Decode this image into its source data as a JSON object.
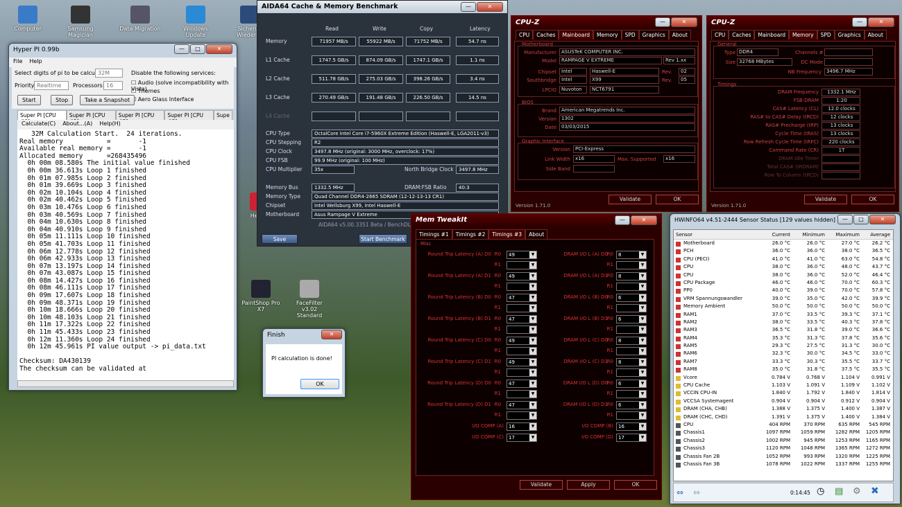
{
  "desktop_icons": [
    {
      "label": "Computer",
      "icon": "computer-icon"
    },
    {
      "label": "Samsung Magician",
      "icon": "ssd-icon"
    },
    {
      "label": "Data Migration",
      "icon": "migration-icon"
    },
    {
      "label": "Windows Update",
      "icon": "update-icon"
    },
    {
      "label": "Sicherun Wiederhe",
      "icon": "backup-icon"
    },
    {
      "label": "PaintShop Pro X7",
      "icon": "paintshop-icon"
    },
    {
      "label": "FaceFilter v3.02 Standard",
      "icon": "facefilter-icon"
    },
    {
      "label": "Hero 2",
      "icon": "hero-icon"
    }
  ],
  "hyperpi": {
    "title": "Hyper PI 0.99b",
    "menu": [
      "File",
      "Help"
    ],
    "digits_label": "Select digits of pi to be calculated:",
    "digits_value": "32M",
    "disable_label": "Disable the following services:",
    "checks": [
      "Audio (solve incompatibility with Vista)",
      "Themes",
      "Aero Glass Interface"
    ],
    "priority_label": "Priority:",
    "priority_value": "Realtime",
    "processors_label": "Processors:",
    "processors_value": "16",
    "buttons": [
      "Start",
      "Stop",
      "Take a Snapshot"
    ],
    "tabs": [
      "Super PI [CPU #0]",
      "Super PI [CPU #1]",
      "Super PI [CPU #2]",
      "Super PI [CPU #3]",
      "Supe"
    ],
    "submenu": [
      "Calculate(C)",
      "About...(A)",
      "Help(H)"
    ],
    "console": "   32M Calculation Start.  24 iterations.\nReal memory           =       -1\nAvailable real memory =       -1\nAllocated memory      =268435496\n  0h 00m 08.580s The initial value finished\n  0h 00m 36.613s Loop 1 finished\n  0h 01m 07.985s Loop 2 finished\n  0h 01m 39.669s Loop 3 finished\n  0h 02m 10.104s Loop 4 finished\n  0h 02m 40.462s Loop 5 finished\n  0h 03m 10.476s Loop 6 finished\n  0h 03m 40.569s Loop 7 finished\n  0h 04m 10.630s Loop 8 finished\n  0h 04m 40.910s Loop 9 finished\n  0h 05m 11.111s Loop 10 finished\n  0h 05m 41.703s Loop 11 finished\n  0h 06m 12.778s Loop 12 finished\n  0h 06m 42.933s Loop 13 finished\n  0h 07m 13.197s Loop 14 finished\n  0h 07m 43.087s Loop 15 finished\n  0h 08m 14.427s Loop 16 finished\n  0h 08m 46.111s Loop 17 finished\n  0h 09m 17.607s Loop 18 finished\n  0h 09m 48.371s Loop 19 finished\n  0h 10m 18.666s Loop 20 finished\n  0h 10m 48.103s Loop 21 finished\n  0h 11m 17.322s Loop 22 finished\n  0h 11m 45.433s Loop 23 finished\n  0h 12m 11.360s Loop 24 finished\n  0h 12m 45.961s PI value output -> pi_data.txt\n\nChecksum: DA430139\nThe checksum can be validated at"
  },
  "finish": {
    "title": "Finish",
    "message": "PI calculation is done!",
    "ok": "OK"
  },
  "aida": {
    "title": "AIDA64 Cache & Memory Benchmark",
    "headers": [
      "Read",
      "Write",
      "Copy",
      "Latency"
    ],
    "rows": [
      {
        "label": "Memory",
        "vals": [
          "71957 MB/s",
          "55922 MB/s",
          "71752 MB/s",
          "54.7 ns"
        ]
      },
      {
        "label": "L1 Cache",
        "vals": [
          "1747.5 GB/s",
          "874.09 GB/s",
          "1747.1 GB/s",
          "1.1 ns"
        ]
      },
      {
        "label": "L2 Cache",
        "vals": [
          "511.78 GB/s",
          "275.03 GB/s",
          "398.26 GB/s",
          "3.4 ns"
        ]
      },
      {
        "label": "L3 Cache",
        "vals": [
          "270.49 GB/s",
          "191.48 GB/s",
          "226.50 GB/s",
          "14.5 ns"
        ]
      },
      {
        "label": "L4 Cache",
        "vals": [
          "",
          "",
          "",
          ""
        ]
      }
    ],
    "info": [
      {
        "label": "CPU Type",
        "value": "OctalCore Intel Core i7-5960X Extreme Edition  (Haswell-E, LGA2011-v3)"
      },
      {
        "label": "CPU Stepping",
        "value": "R2"
      },
      {
        "label": "CPU Clock",
        "value": "3497.8 MHz  (original: 3000 MHz, overclock: 17%)"
      },
      {
        "label": "CPU FSB",
        "value": "99.9 MHz  (original: 100 MHz)"
      },
      {
        "label": "CPU Multiplier",
        "value": "35x"
      }
    ],
    "nb_label": "North Bridge Clock",
    "nb_value": "3497.8 MHz",
    "membus_label": "Memory Bus",
    "membus_value": "1332.5 MHz",
    "ratio_label": "DRAM:FSB Ratio",
    "ratio_value": "40:3",
    "info2": [
      {
        "label": "Memory Type",
        "value": "Quad Channel DDR4-2665 SDRAM  (12-12-13-13 CR1)"
      },
      {
        "label": "Chipset",
        "value": "Intel Wellsburg X99, Intel Haswell-E"
      },
      {
        "label": "Motherboard",
        "value": "Asus Rampage V Extreme"
      }
    ],
    "footer": "AIDA64 v5.00.3351 Beta / BenchDLL 4.",
    "save": "Save",
    "start": "Start Benchmark"
  },
  "cpuz1": {
    "title": "CPU-Z",
    "tabs": [
      "CPU",
      "Caches",
      "Mainboard",
      "Memory",
      "SPD",
      "Graphics",
      "About"
    ],
    "active": "Mainboard",
    "mb_group": "Motherboard",
    "manufacturer_label": "Manufacturer",
    "manufacturer": "ASUSTeK COMPUTER INC.",
    "model_label": "Model",
    "model": "RAMPAGE V EXTREME",
    "model_rev": "Rev 1.xx",
    "chipset_label": "Chipset",
    "chipset_vendor": "Intel",
    "chipset_name": "Haswell-E",
    "rev_label": "Rev.",
    "chipset_rev": "02",
    "south_label": "Southbridge",
    "south_vendor": "Intel",
    "south_name": "X99",
    "south_rev": "05",
    "lpcio_label": "LPCIO",
    "lpcio_vendor": "Nuvoton",
    "lpcio_name": "NCT6791",
    "bios_group": "BIOS",
    "brand_label": "Brand",
    "brand": "American Megatrends Inc.",
    "version_label": "Version",
    "version": "1302",
    "date_label": "Date",
    "date": "03/03/2015",
    "gi_group": "Graphic Interface",
    "gi_version_label": "Version",
    "gi_version": "PCI-Express",
    "link_label": "Link Width",
    "link": "x16",
    "max_label": "Max. Supported",
    "max": "x16",
    "side_label": "Side Band",
    "validate": "Validate",
    "ok": "OK",
    "ver": "Version 1.71.0"
  },
  "cpuz2": {
    "title": "CPU-Z",
    "tabs": [
      "CPU",
      "Caches",
      "Mainboard",
      "Memory",
      "SPD",
      "Graphics",
      "About"
    ],
    "active": "Memory",
    "general_group": "General",
    "type_label": "Type",
    "type": "DDR4",
    "channels_label": "Channels #",
    "size_label": "Size",
    "size": "32768 MBytes",
    "dc_label": "DC Mode",
    "nb_label": "NB Frequency",
    "nb": "3496.7 MHz",
    "timings_group": "Timings",
    "timings": [
      {
        "label": "DRAM Frequency",
        "value": "1332.1 MHz"
      },
      {
        "label": "FSB:DRAM",
        "value": "1:20"
      },
      {
        "label": "CAS# Latency (CL)",
        "value": "12.0 clocks"
      },
      {
        "label": "RAS# to CAS# Delay (tRCD)",
        "value": "12 clocks"
      },
      {
        "label": "RAS# Precharge (tRP)",
        "value": "13 clocks"
      },
      {
        "label": "Cycle Time (tRAS)",
        "value": "13 clocks"
      },
      {
        "label": "Row Refresh Cycle Time (tRFC)",
        "value": "220 clocks"
      },
      {
        "label": "Command Rate (CR)",
        "value": "1T"
      },
      {
        "label": "DRAM Idle Timer",
        "value": ""
      },
      {
        "label": "Total CAS# (tRDRAM)",
        "value": ""
      },
      {
        "label": "Row To Column (tRCD)",
        "value": ""
      }
    ],
    "validate": "Validate",
    "ok": "OK",
    "ver": "Version 1.71.0"
  },
  "mti": {
    "title": "Mem TweakIt",
    "tabs": [
      "Timings #1",
      "Timings #2",
      "Timings #3",
      "About"
    ],
    "active": "Timings #3",
    "group": "Misc",
    "left": [
      {
        "label": "Round Trip Latency (A) D0",
        "r0": "49"
      },
      {
        "label": "Round Trip Latency (A) D1",
        "r0": "49"
      },
      {
        "label": "Round Trip Latency (B) D0",
        "r0": "47"
      },
      {
        "label": "Round Trip Latency (B) D1",
        "r0": "47"
      },
      {
        "label": "Round Trip Latency (C) D0",
        "r0": "49"
      },
      {
        "label": "Round Trip Latency (C) D1",
        "r0": "49"
      },
      {
        "label": "Round Trip Latency (D) D0",
        "r0": "47"
      },
      {
        "label": "Round Trip Latency (D) D1",
        "r0": "47"
      }
    ],
    "right": [
      {
        "label": "DRAM I/O L (A) D0",
        "r0": "8"
      },
      {
        "label": "DRAM I/O L (A) D1",
        "r0": "8"
      },
      {
        "label": "DRAM I/O L (B) D0",
        "r0": "6"
      },
      {
        "label": "DRAM I/O L (B) D1",
        "r0": "6"
      },
      {
        "label": "DRAM I/O L (C) D0",
        "r0": "8"
      },
      {
        "label": "DRAM I/O L (C) D1",
        "r0": "8"
      },
      {
        "label": "DRAM I/O L (D) D0",
        "r0": "6"
      },
      {
        "label": "DRAM I/O L (D) D1",
        "r0": "6"
      }
    ],
    "r0": "R0",
    "r1": "R1",
    "io": [
      {
        "label": "I/O COMP (A)",
        "value": "16"
      },
      {
        "label": "I/O COMP (C)",
        "value": "17"
      },
      {
        "label": "I/O COMP (B)",
        "value": "16"
      },
      {
        "label": "I/O COMP (D)",
        "value": "17"
      }
    ],
    "validate": "Validate",
    "apply": "Apply",
    "ok": "OK"
  },
  "hw": {
    "title": "HWiNFO64 v4.51-2444 Sensor Status [129 values hidden]",
    "cols": [
      "Sensor",
      "Current",
      "Minimum",
      "Maximum",
      "Average"
    ],
    "rows": [
      [
        "Motherboard",
        "26.0 °C",
        "26.0 °C",
        "27.0 °C",
        "26.2 °C",
        "t"
      ],
      [
        "PCH",
        "36.0 °C",
        "36.0 °C",
        "38.0 °C",
        "36.5 °C",
        "t"
      ],
      [
        "CPU (PECI)",
        "41.0 °C",
        "41.0 °C",
        "63.0 °C",
        "54.8 °C",
        "t"
      ],
      [
        "CPU",
        "38.0 °C",
        "36.0 °C",
        "48.0 °C",
        "43.7 °C",
        "t"
      ],
      [
        "CPU",
        "38.0 °C",
        "36.0 °C",
        "52.0 °C",
        "46.4 °C",
        "t"
      ],
      [
        "CPU Package",
        "46.0 °C",
        "46.0 °C",
        "70.0 °C",
        "60.3 °C",
        "t"
      ],
      [
        "PP0",
        "40.0 °C",
        "39.0 °C",
        "70.0 °C",
        "57.8 °C",
        "t"
      ],
      [
        "VRM Spannungswandler",
        "39.0 °C",
        "35.0 °C",
        "42.0 °C",
        "39.9 °C",
        "t"
      ],
      [
        "Memory Ambient",
        "50.0 °C",
        "50.0 °C",
        "50.0 °C",
        "50.0 °C",
        "t"
      ],
      [
        "RAM1",
        "37.0 °C",
        "33.5 °C",
        "39.3 °C",
        "37.1 °C",
        "t"
      ],
      [
        "RAM2",
        "38.0 °C",
        "33.5 °C",
        "40.3 °C",
        "37.8 °C",
        "t"
      ],
      [
        "RAM3",
        "36.5 °C",
        "31.8 °C",
        "39.0 °C",
        "36.6 °C",
        "t"
      ],
      [
        "RAM4",
        "35.3 °C",
        "31.3 °C",
        "37.8 °C",
        "35.6 °C",
        "t"
      ],
      [
        "RAM5",
        "29.3 °C",
        "27.5 °C",
        "31.3 °C",
        "30.0 °C",
        "t"
      ],
      [
        "RAM6",
        "32.3 °C",
        "30.0 °C",
        "34.5 °C",
        "33.0 °C",
        "t"
      ],
      [
        "RAM7",
        "33.3 °C",
        "30.3 °C",
        "35.5 °C",
        "33.7 °C",
        "t"
      ],
      [
        "RAM8",
        "35.0 °C",
        "31.8 °C",
        "37.5 °C",
        "35.5 °C",
        "t"
      ],
      [
        "Vcore",
        "0.784 V",
        "0.768 V",
        "1.104 V",
        "0.991 V",
        "v"
      ],
      [
        "CPU Cache",
        "1.103 V",
        "1.091 V",
        "1.109 V",
        "1.102 V",
        "v"
      ],
      [
        "VCCIN CPU-IN",
        "1.840 V",
        "1.792 V",
        "1.840 V",
        "1.814 V",
        "v"
      ],
      [
        "VCCSA Systemagent",
        "0.904 V",
        "0.904 V",
        "0.912 V",
        "0.904 V",
        "v"
      ],
      [
        "DRAM (CHA, CHB)",
        "1.388 V",
        "1.375 V",
        "1.400 V",
        "1.387 V",
        "v"
      ],
      [
        "DRAM (CHC, CHD)",
        "1.391 V",
        "1.375 V",
        "1.400 V",
        "1.384 V",
        "v"
      ],
      [
        "CPU",
        "404 RPM",
        "370 RPM",
        "635 RPM",
        "545 RPM",
        "f"
      ],
      [
        "Chassis1",
        "1097 RPM",
        "1059 RPM",
        "1282 RPM",
        "1205 RPM",
        "f"
      ],
      [
        "Chassis2",
        "1002 RPM",
        "945 RPM",
        "1253 RPM",
        "1165 RPM",
        "f"
      ],
      [
        "Chassis3",
        "1120 RPM",
        "1048 RPM",
        "1365 RPM",
        "1272 RPM",
        "f"
      ],
      [
        "Chassis Fan 2B",
        "1052 RPM",
        "993 RPM",
        "1320 RPM",
        "1225 RPM",
        "f"
      ],
      [
        "Chassis Fan 3B",
        "1078 RPM",
        "1022 RPM",
        "1337 RPM",
        "1255 RPM",
        "f"
      ]
    ],
    "timer": "0:14:45"
  },
  "colors": {
    "cpuz_red": "#cc3333",
    "aida_bg": "#2a323c"
  }
}
